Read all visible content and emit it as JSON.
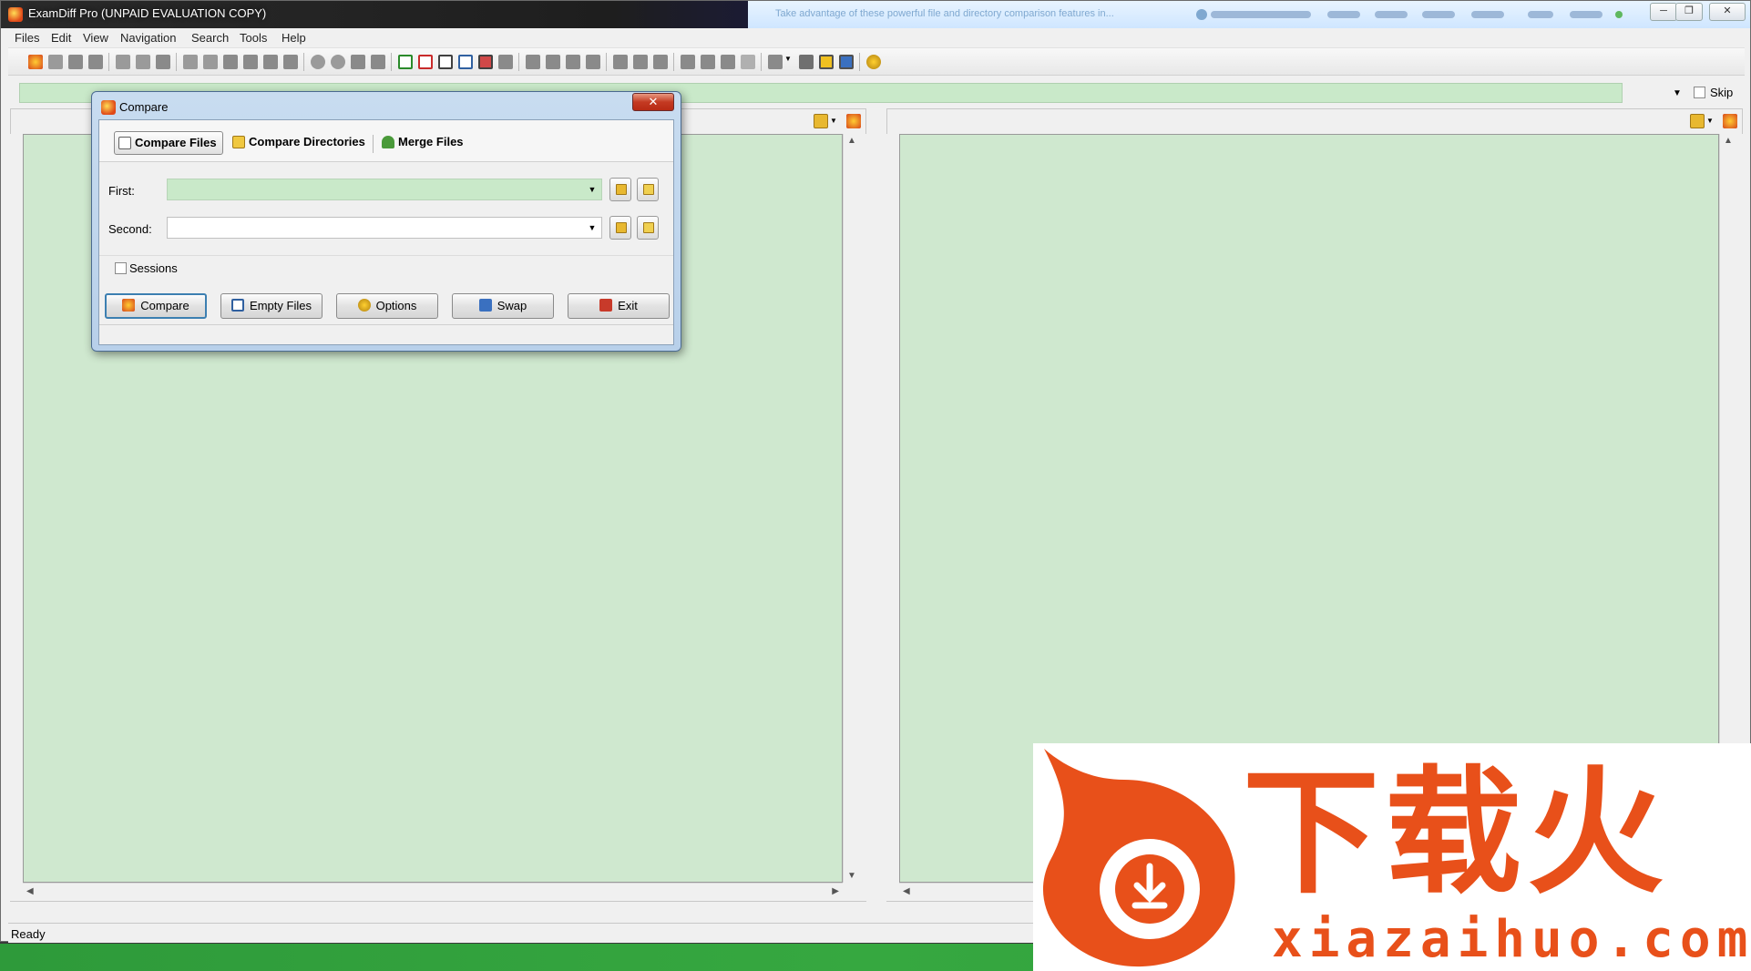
{
  "window": {
    "title": "ExamDiff Pro (UNPAID EVALUATION COPY)",
    "notice": "Take advantage of these powerful file and directory comparison features in..."
  },
  "menu": [
    "Files",
    "Edit",
    "View",
    "Navigation",
    "Search",
    "Tools",
    "Help"
  ],
  "address": {
    "skip_label": "Skip"
  },
  "status": {
    "text": "Ready"
  },
  "dialog": {
    "title": "Compare",
    "tabs": [
      "Compare Files",
      "Compare Directories",
      "Merge Files"
    ],
    "first_label": "First:",
    "second_label": "Second:",
    "first_value": "",
    "second_value": "",
    "sessions_label": "Sessions",
    "buttons": [
      "Compare",
      "Empty Files",
      "Options",
      "Swap",
      "Exit"
    ]
  },
  "watermark": {
    "brand_cn": "下载火",
    "domain": "xiazaihuo.com"
  },
  "colors": {
    "pane_bg": "#cfe8cf",
    "accent": "#3c7fb1",
    "watermark_orange": "#e8501a",
    "taskbar": "#36a840"
  },
  "icons": [
    "app-icon",
    "close-icon",
    "open-folder-icon",
    "paste-icon",
    "dropdown-arrow-icon"
  ]
}
